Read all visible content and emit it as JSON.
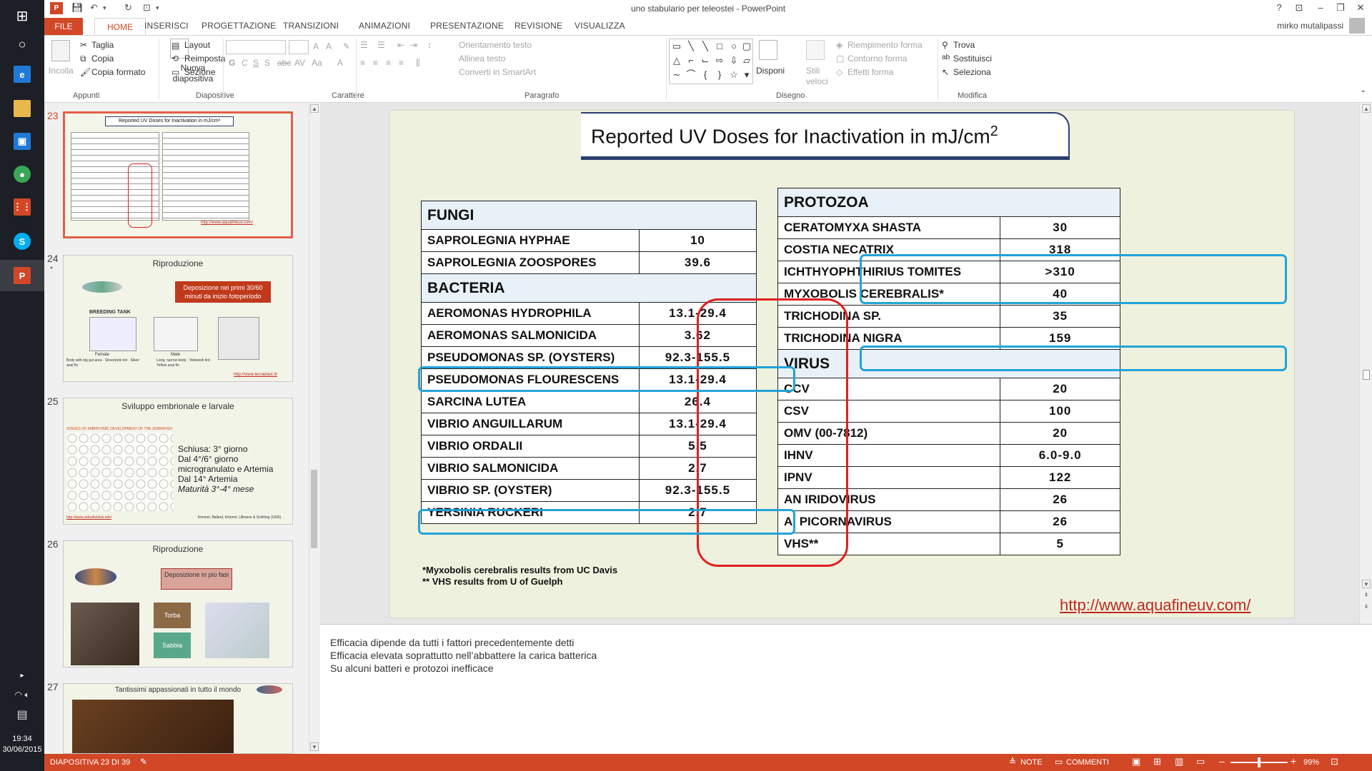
{
  "window": {
    "title": "uno stabulario per teleostei - PowerPoint",
    "user": "mirko mutalipassi",
    "controls": [
      "?",
      "⊡",
      "–",
      "❐",
      "✕"
    ]
  },
  "taskbar": {
    "clock_time": "19:34",
    "clock_date": "30/06/2015",
    "apps": [
      "windows-start",
      "cortana",
      "ie",
      "file-explorer",
      "store",
      "chrome",
      "apps",
      "skype",
      "powerpoint"
    ]
  },
  "ribbon": {
    "tabs": [
      "FILE",
      "HOME",
      "INSERISCI",
      "PROGETTAZIONE",
      "TRANSIZIONI",
      "ANIMAZIONI",
      "PRESENTAZIONE",
      "REVISIONE",
      "VISUALIZZA"
    ],
    "clipboard": {
      "paste": "Incolla",
      "cut": "Taglia",
      "copy": "Copia",
      "format": "Copia formato",
      "label": "Appunti"
    },
    "slides": {
      "new": "Nuova diapositiva",
      "layout": "Layout",
      "reset": "Reimposta",
      "section": "Sezione",
      "label": "Diapositive"
    },
    "font": {
      "label": "Carattere",
      "bold": "G",
      "italic": "C",
      "underline": "S",
      "strike": "S",
      "spacing": "abc",
      "case": "Aa"
    },
    "paragraph": {
      "label": "Paragrafo",
      "orientation": "Orientamento testo",
      "align": "Allinea testo",
      "smartart": "Converti in SmartArt"
    },
    "drawing": {
      "label": "Disegno",
      "arrange": "Disponi",
      "quick_styles": "Stili veloci",
      "fill": "Riempimento forma",
      "outline": "Contorno forma",
      "effects": "Effetti forma"
    },
    "editing": {
      "label": "Modifica",
      "find": "Trova",
      "replace": "Sostituisci",
      "select": "Seleziona"
    }
  },
  "thumbnails": [
    {
      "num": "23",
      "title": "Reported UV Doses for Inactivation in mJ/cm²",
      "selected": true
    },
    {
      "num": "24",
      "title": "Riproduzione",
      "callout": "Deposizione nei primi 30/60 minuti da inizio fotoperiodo",
      "tank_label": "BREEDING TANK",
      "female": "Female",
      "male": "Male",
      "note": "Body with big gut area · Silver/pink tint · Silver anal fin",
      "male_note": "Long, narrow body · Yellowish tint · Yellow anal fin",
      "link": "http://www.tecniplast.it/"
    },
    {
      "num": "25",
      "title": "Sviluppo embrionale e larvale",
      "stages_label": "STAGES OF EMBRYONIC DEVELOPMENT OF THE ZEBRAFISH",
      "lines": [
        "Schiusa: 3° giorno",
        "Dal 4°/6° giorno",
        "microgranulato e Artemia",
        "Dal 14° Artemia",
        "Maturità 3°-4° mese"
      ],
      "link": "http://www.zebrafishlink.info/",
      "ref": "Kimmel, Ballard, Kimmel, Ullmann & Schilling (1995)"
    },
    {
      "num": "26",
      "title": "Riproduzione",
      "callout": "Deposizione in più fasi",
      "labels": [
        "Torba",
        "Sabbia"
      ]
    },
    {
      "num": "27",
      "title": "Tantissimi appassionati in tutto il mondo"
    }
  ],
  "slide": {
    "title": "Reported UV Doses for Inactivation in mJ/cm",
    "title_sup": "2",
    "left_table": {
      "sections": [
        {
          "header": "FUNGI",
          "rows": [
            [
              "SAPROLEGNIA HYPHAE",
              "10"
            ],
            [
              "SAPROLEGNIA ZOOSPORES",
              "39.6"
            ]
          ]
        },
        {
          "header": "BACTERIA",
          "rows": [
            [
              "AEROMONAS HYDROPHILA",
              "13.1-29.4"
            ],
            [
              "AEROMONAS SALMONICIDA",
              "3.62"
            ],
            [
              "PSEUDOMONAS SP. (OYSTERS)",
              "92.3-155.5"
            ],
            [
              "PSEUDOMONAS FLOURESCENS",
              "13.1-29.4"
            ],
            [
              "SARCINA LUTEA",
              "26.4"
            ],
            [
              "VIBRIO ANGUILLARUM",
              "13.1-29.4"
            ],
            [
              "VIBRIO ORDALII",
              "5.5"
            ],
            [
              "VIBRIO SALMONICIDA",
              "2.7"
            ],
            [
              "VIBRIO SP. (OYSTER)",
              "92.3-155.5"
            ],
            [
              "YERSINIA RUCKERI",
              "2.7"
            ]
          ]
        }
      ]
    },
    "right_table": {
      "sections": [
        {
          "header": "PROTOZOA",
          "rows": [
            [
              "CERATOMYXA SHASTA",
              "30"
            ],
            [
              "COSTIA NECATRIX",
              "318"
            ],
            [
              "ICHTHYOPHTHIRIUS TOMITES",
              ">310"
            ],
            [
              "MYXOBOLIS CEREBRALIS*",
              "40"
            ],
            [
              "TRICHODINA SP.",
              "35"
            ],
            [
              "TRICHODINA NIGRA",
              "159"
            ]
          ]
        },
        {
          "header": "VIRUS",
          "rows": [
            [
              "CCV",
              "20"
            ],
            [
              "CSV",
              "100"
            ],
            [
              "OMV (00-7812)",
              "20"
            ],
            [
              "IHNV",
              "6.0-9.0"
            ],
            [
              "IPNV",
              "122"
            ],
            [
              "AN IRIDOVIRUS",
              "26"
            ],
            [
              "A. PICORNAVIRUS",
              "26"
            ],
            [
              "VHS**",
              "5"
            ]
          ]
        }
      ]
    },
    "footnotes": [
      "*Myxobolis cerebralis results from UC Davis",
      "** VHS results from U of Guelph"
    ],
    "link": "http://www.aquafineuv.com/"
  },
  "notes": [
    "Efficacia dipende da tutti i fattori precedentemente detti",
    "Efficacia elevata soprattutto nell’abbattere la carica batterica",
    "Su alcuni batteri e protozoi inefficace"
  ],
  "status": {
    "slide_info": "DIAPOSITIVA 23 DI 39",
    "notes": "NOTE",
    "comments": "COMMENTI",
    "zoom": "99%"
  },
  "colors": {
    "accent": "#d24726",
    "highlight_blue": "#22a3d8",
    "highlight_red": "#e02020",
    "title_navy": "#2a3e6e"
  }
}
